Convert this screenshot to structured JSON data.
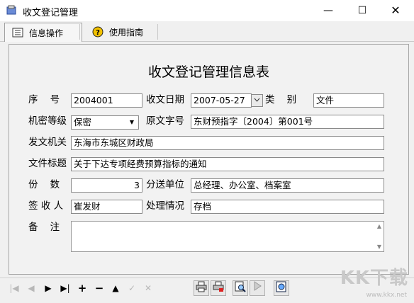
{
  "window": {
    "title": "收文登记管理",
    "minimize": "—",
    "maximize": "☐",
    "close": "✕"
  },
  "tabs": [
    {
      "label": "信息操作",
      "icon": "list-icon",
      "active": true
    },
    {
      "label": "使用指南",
      "icon": "help-icon",
      "active": false
    }
  ],
  "form": {
    "title": "收文登记管理信息表",
    "labels": {
      "serial": "序    号",
      "receive_date": "收文日期",
      "category": "类    别",
      "secrecy": "机密等级",
      "original_no": "原文字号",
      "issuer": "发文机关",
      "doc_title": "文件标题",
      "copies": "份    数",
      "distribution": "分送单位",
      "signer": "签 收 人",
      "handling": "处理情况",
      "remarks": "备    注"
    },
    "values": {
      "serial": "2004001",
      "receive_date": "2007-05-27",
      "category": "文件",
      "secrecy": "保密",
      "original_no": "东财预指字〔2004〕第001号",
      "issuer": "东海市东城区财政局",
      "doc_title": "关于下达专项经费预算指标的通知",
      "copies": "3",
      "distribution": "总经理、办公室、档案室",
      "signer": "崔发财",
      "handling": "存档",
      "remarks": ""
    }
  },
  "navigator": {
    "first": "|◀",
    "prior": "◀",
    "next": "▶",
    "last": "▶|",
    "insert": "+",
    "delete": "−",
    "edit": "▲",
    "post": "✓",
    "cancel": "✕"
  },
  "watermark": {
    "brand": "KK下载",
    "url": "www.kkx.net"
  }
}
